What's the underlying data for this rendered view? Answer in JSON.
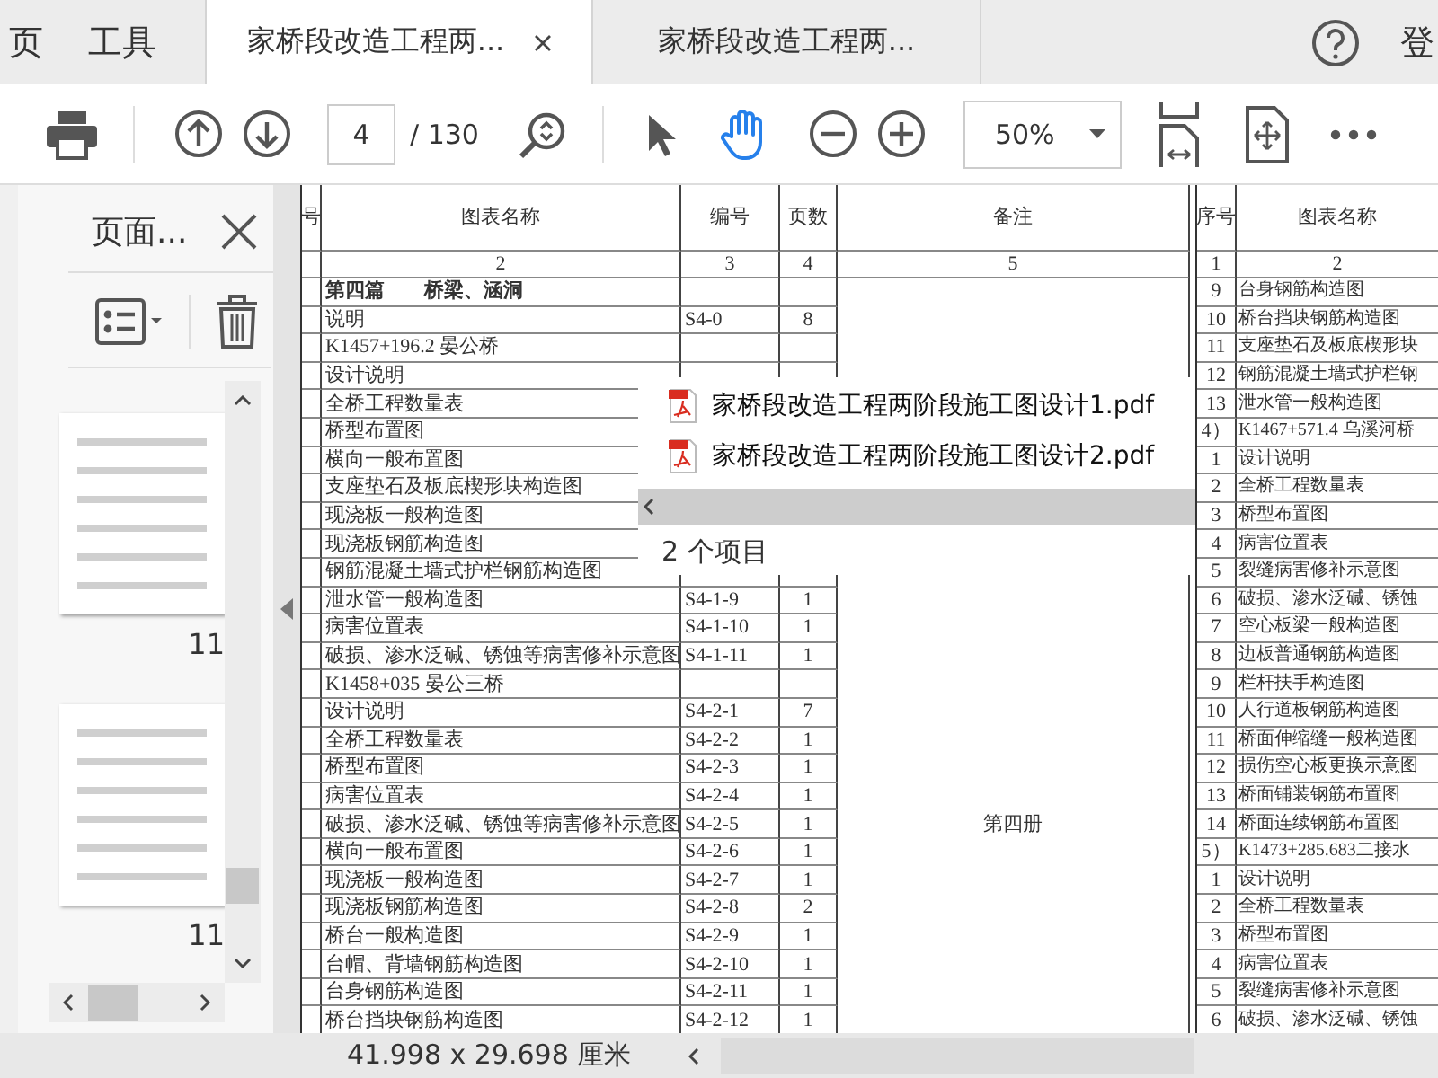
{
  "menu_tabs": [
    {
      "label": "页"
    },
    {
      "label": "工具"
    }
  ],
  "doc_tabs": [
    {
      "label": "家桥段改造工程两...",
      "selected": true
    },
    {
      "label": "家桥段改造工程两...",
      "selected": false
    }
  ],
  "account": {
    "label": "登"
  },
  "toolbar": {
    "page": "4",
    "page_total": "/ 130",
    "zoom": "50%",
    "tools": [
      {
        "kind": "select",
        "selected": false
      },
      {
        "kind": "hand",
        "selected": true
      }
    ]
  },
  "side_panel": {
    "title": "页面...",
    "thumbnails": [
      {
        "label": "11"
      },
      {
        "label": "11"
      }
    ]
  },
  "left_table": {
    "columns": [
      "号",
      "图表名称",
      "编号",
      "页数",
      "备注"
    ],
    "numbers": [
      "2",
      "3",
      "4",
      "5"
    ],
    "rows": [
      {
        "kind": "section",
        "name": "第四篇　　桥梁、涵洞",
        "code": "",
        "pages": "",
        "note": ""
      },
      {
        "kind": "item",
        "name": "说明",
        "code": "S4-0",
        "pages": "8",
        "note": ""
      },
      {
        "kind": "item",
        "name": "K1457+196.2 晏公桥",
        "code": "",
        "pages": "",
        "note": ""
      },
      {
        "kind": "item",
        "name": "设计说明",
        "code": "",
        "pages": "",
        "note": ""
      },
      {
        "kind": "item",
        "name": "全桥工程数量表",
        "code": "",
        "pages": "",
        "note": ""
      },
      {
        "kind": "item",
        "name": "桥型布置图",
        "code": "",
        "pages": "",
        "note": ""
      },
      {
        "kind": "item",
        "name": "横向一般布置图",
        "code": "",
        "pages": "",
        "note": ""
      },
      {
        "kind": "item",
        "name": "支座垫石及板底楔形块构造图",
        "code": "",
        "pages": "",
        "note": ""
      },
      {
        "kind": "item",
        "name": "现浇板一般构造图",
        "code": "",
        "pages": "",
        "note": ""
      },
      {
        "kind": "item",
        "name": "现浇板钢筋构造图",
        "code": "",
        "pages": "",
        "note": ""
      },
      {
        "kind": "item",
        "name": "钢筋混凝土墙式护栏钢筋构造图",
        "code": "",
        "pages": "",
        "note": ""
      },
      {
        "kind": "item",
        "name": "泄水管一般构造图",
        "code": "S4-1-9",
        "pages": "1",
        "note": ""
      },
      {
        "kind": "item",
        "name": "病害位置表",
        "code": "S4-1-10",
        "pages": "1",
        "note": ""
      },
      {
        "kind": "item",
        "name": "破损、渗水泛碱、锈蚀等病害修补示意图",
        "code": "S4-1-11",
        "pages": "1",
        "note": ""
      },
      {
        "kind": "item",
        "name": "K1458+035 晏公三桥",
        "code": "",
        "pages": "",
        "note": ""
      },
      {
        "kind": "item",
        "name": "设计说明",
        "code": "S4-2-1",
        "pages": "7",
        "note": ""
      },
      {
        "kind": "item",
        "name": "全桥工程数量表",
        "code": "S4-2-2",
        "pages": "1",
        "note": ""
      },
      {
        "kind": "item",
        "name": "桥型布置图",
        "code": "S4-2-3",
        "pages": "1",
        "note": ""
      },
      {
        "kind": "item",
        "name": "病害位置表",
        "code": "S4-2-4",
        "pages": "1",
        "note": ""
      },
      {
        "kind": "item",
        "name": "破损、渗水泛碱、锈蚀等病害修补示意图",
        "code": "S4-2-5",
        "pages": "1",
        "note": "第四册"
      },
      {
        "kind": "item",
        "name": "横向一般布置图",
        "code": "S4-2-6",
        "pages": "1",
        "note": ""
      },
      {
        "kind": "item",
        "name": "现浇板一般构造图",
        "code": "S4-2-7",
        "pages": "1",
        "note": ""
      },
      {
        "kind": "item",
        "name": "现浇板钢筋构造图",
        "code": "S4-2-8",
        "pages": "2",
        "note": ""
      },
      {
        "kind": "item",
        "name": "桥台一般构造图",
        "code": "S4-2-9",
        "pages": "1",
        "note": ""
      },
      {
        "kind": "item",
        "name": "台帽、背墙钢筋构造图",
        "code": "S4-2-10",
        "pages": "1",
        "note": ""
      },
      {
        "kind": "item",
        "name": "台身钢筋构造图",
        "code": "S4-2-11",
        "pages": "1",
        "note": ""
      },
      {
        "kind": "item",
        "name": "桥台挡块钢筋构造图",
        "code": "S4-2-12",
        "pages": "1",
        "note": ""
      }
    ]
  },
  "right_table": {
    "columns": [
      "序号",
      "图表名称"
    ],
    "numbers": [
      "1",
      "2"
    ],
    "rows": [
      {
        "no": "9",
        "name": "台身钢筋构造图"
      },
      {
        "no": "10",
        "name": "桥台挡块钢筋构造图"
      },
      {
        "no": "11",
        "name": "支座垫石及板底楔形块"
      },
      {
        "no": "12",
        "name": "钢筋混凝土墙式护栏钢"
      },
      {
        "no": "13",
        "name": "泄水管一般构造图"
      },
      {
        "no": "4）",
        "name": "K1467+571.4 乌溪河桥"
      },
      {
        "no": "1",
        "name": "设计说明"
      },
      {
        "no": "2",
        "name": "全桥工程数量表"
      },
      {
        "no": "3",
        "name": "桥型布置图"
      },
      {
        "no": "4",
        "name": "病害位置表"
      },
      {
        "no": "5",
        "name": "裂缝病害修补示意图"
      },
      {
        "no": "6",
        "name": "破损、渗水泛碱、锈蚀"
      },
      {
        "no": "7",
        "name": "空心板梁一般构造图"
      },
      {
        "no": "8",
        "name": "边板普通钢筋构造图"
      },
      {
        "no": "9",
        "name": "栏杆扶手构造图"
      },
      {
        "no": "10",
        "name": "人行道板钢筋构造图"
      },
      {
        "no": "11",
        "name": "桥面伸缩缝一般构造图"
      },
      {
        "no": "12",
        "name": "损伤空心板更换示意图"
      },
      {
        "no": "13",
        "name": "桥面铺装钢筋布置图"
      },
      {
        "no": "14",
        "name": "桥面连续钢筋布置图"
      },
      {
        "no": "5）",
        "name": "K1473+285.683二接水"
      },
      {
        "no": "1",
        "name": "设计说明"
      },
      {
        "no": "2",
        "name": "全桥工程数量表"
      },
      {
        "no": "3",
        "name": "桥型布置图"
      },
      {
        "no": "4",
        "name": "病害位置表"
      },
      {
        "no": "5",
        "name": "裂缝病害修补示意图"
      },
      {
        "no": "6",
        "name": "破损、渗水泛碱、锈蚀"
      }
    ]
  },
  "file_popup": {
    "files": [
      {
        "name": "家桥段改造工程两阶段施工图设计1.pdf"
      },
      {
        "name": "家桥段改造工程两阶段施工图设计2.pdf"
      }
    ],
    "count": "2 个项目"
  },
  "status_bar": {
    "size": "41.998 x 29.698 厘米"
  }
}
